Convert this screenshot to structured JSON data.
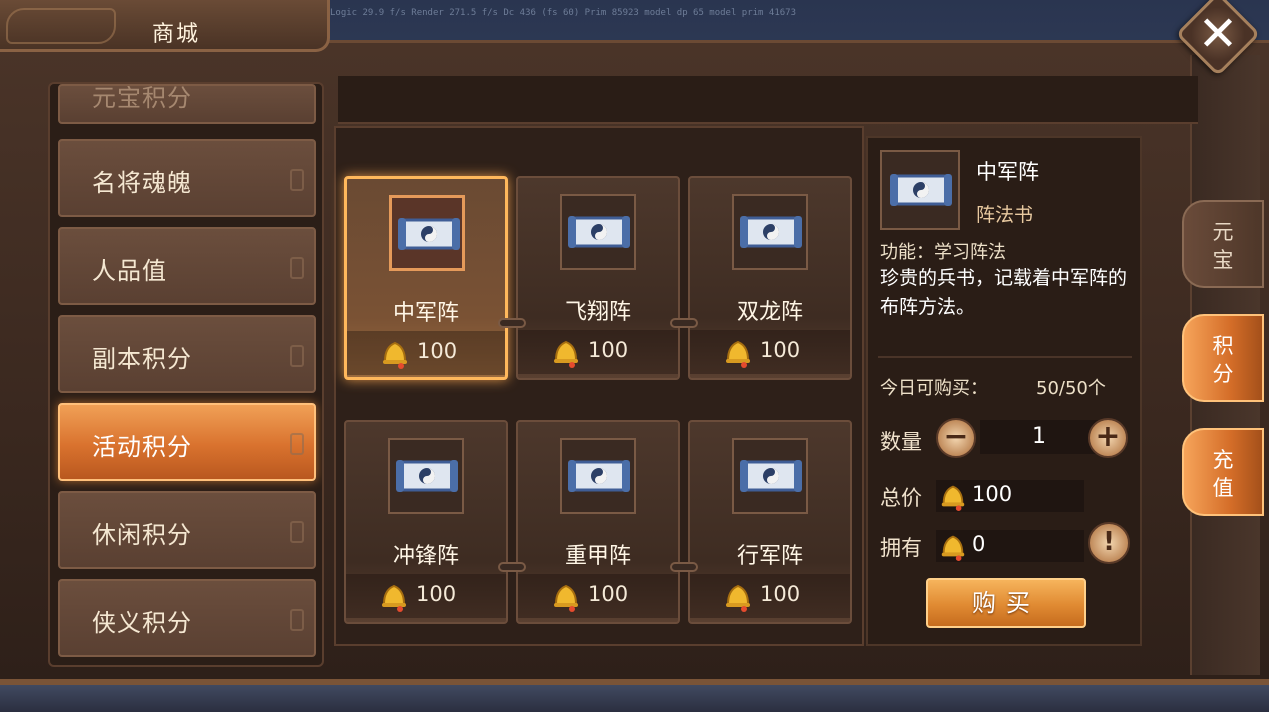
{
  "window": {
    "title": "商城",
    "debug_overlay": "Logic 29.9 f/s  Render 271.5 f/s  Dc 436 (fs 60)  Prim 85923  model dp 65  model prim 41673"
  },
  "categories": [
    {
      "label": "元宝积分",
      "state": "partial"
    },
    {
      "label": "名将魂魄",
      "state": "normal"
    },
    {
      "label": "人品值",
      "state": "normal"
    },
    {
      "label": "副本积分",
      "state": "normal"
    },
    {
      "label": "活动积分",
      "state": "active"
    },
    {
      "label": "休闲积分",
      "state": "normal"
    },
    {
      "label": "侠义积分",
      "state": "normal"
    }
  ],
  "items": [
    {
      "name": "中军阵",
      "price": "100",
      "selected": true
    },
    {
      "name": "飞翔阵",
      "price": "100",
      "selected": false
    },
    {
      "name": "双龙阵",
      "price": "100",
      "selected": false
    },
    {
      "name": "冲锋阵",
      "price": "100",
      "selected": false
    },
    {
      "name": "重甲阵",
      "price": "100",
      "selected": false
    },
    {
      "name": "行军阵",
      "price": "100",
      "selected": false
    }
  ],
  "detail": {
    "name": "中军阵",
    "type": "阵法书",
    "function": "功能：学习阵法",
    "description": "珍贵的兵书，记载着中军阵的布阵方法。",
    "limit_label": "今日可购买：",
    "limit_value": "50/50个",
    "quantity_label": "数量",
    "quantity_value": "1",
    "total_label": "总价",
    "total_value": "100",
    "owned_label": "拥有",
    "owned_value": "0",
    "buy_label": "购买"
  },
  "side_tabs": [
    {
      "label": [
        "元",
        "宝"
      ],
      "active": false
    },
    {
      "label": [
        "积",
        "分"
      ],
      "active": true
    },
    {
      "label": [
        "充",
        "值"
      ],
      "active": true
    }
  ],
  "icons": {
    "currency": "bell-icon",
    "item": "scroll-icon",
    "close": "close-icon",
    "minus": "minus-icon",
    "plus": "plus-icon",
    "info": "exclamation-icon"
  },
  "colors": {
    "accent": "#e08a32",
    "panel": "#3a281f",
    "selected_border": "#ffb85c"
  }
}
